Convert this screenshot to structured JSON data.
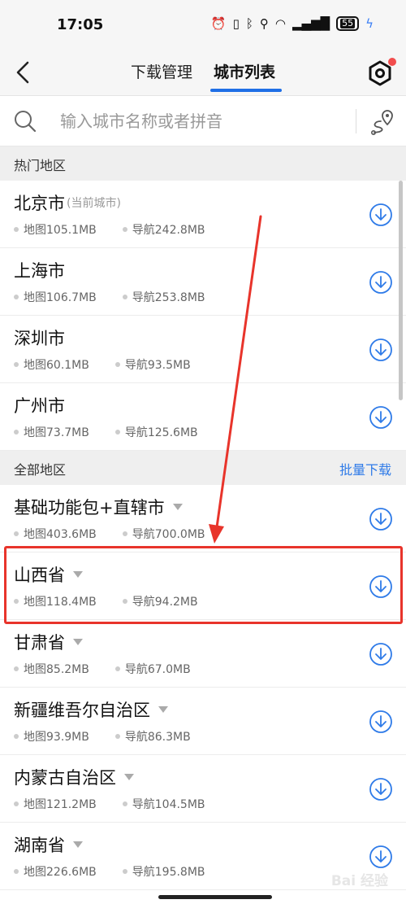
{
  "status": {
    "time": "17:05",
    "battery": "55"
  },
  "nav": {
    "tabs": [
      {
        "label": "下载管理"
      },
      {
        "label": "城市列表"
      }
    ]
  },
  "search": {
    "placeholder": "输入城市名称或者拼音"
  },
  "hot": {
    "title": "热门地区",
    "items": [
      {
        "name": "北京市",
        "note": "(当前城市)",
        "map": "地图105.1MB",
        "nav": "导航242.8MB"
      },
      {
        "name": "上海市",
        "map": "地图106.7MB",
        "nav": "导航253.8MB"
      },
      {
        "name": "深圳市",
        "map": "地图60.1MB",
        "nav": "导航93.5MB"
      },
      {
        "name": "广州市",
        "map": "地图73.7MB",
        "nav": "导航125.6MB"
      }
    ]
  },
  "all": {
    "title": "全部地区",
    "batch_label": "批量下载",
    "items": [
      {
        "name": "基础功能包+直辖市",
        "map": "地图403.6MB",
        "nav": "导航700.0MB"
      },
      {
        "name": "山西省",
        "map": "地图118.4MB",
        "nav": "导航94.2MB"
      },
      {
        "name": "甘肃省",
        "map": "地图85.2MB",
        "nav": "导航67.0MB"
      },
      {
        "name": "新疆维吾尔自治区",
        "map": "地图93.9MB",
        "nav": "导航86.3MB"
      },
      {
        "name": "内蒙古自治区",
        "map": "地图121.2MB",
        "nav": "导航104.5MB"
      },
      {
        "name": "湖南省",
        "map": "地图226.6MB",
        "nav": "导航195.8MB"
      }
    ]
  },
  "colors": {
    "accent": "#1f6fe6",
    "highlight": "#e8342b",
    "notify_dot": "#f24d4d"
  },
  "watermark": "Bai 经验"
}
